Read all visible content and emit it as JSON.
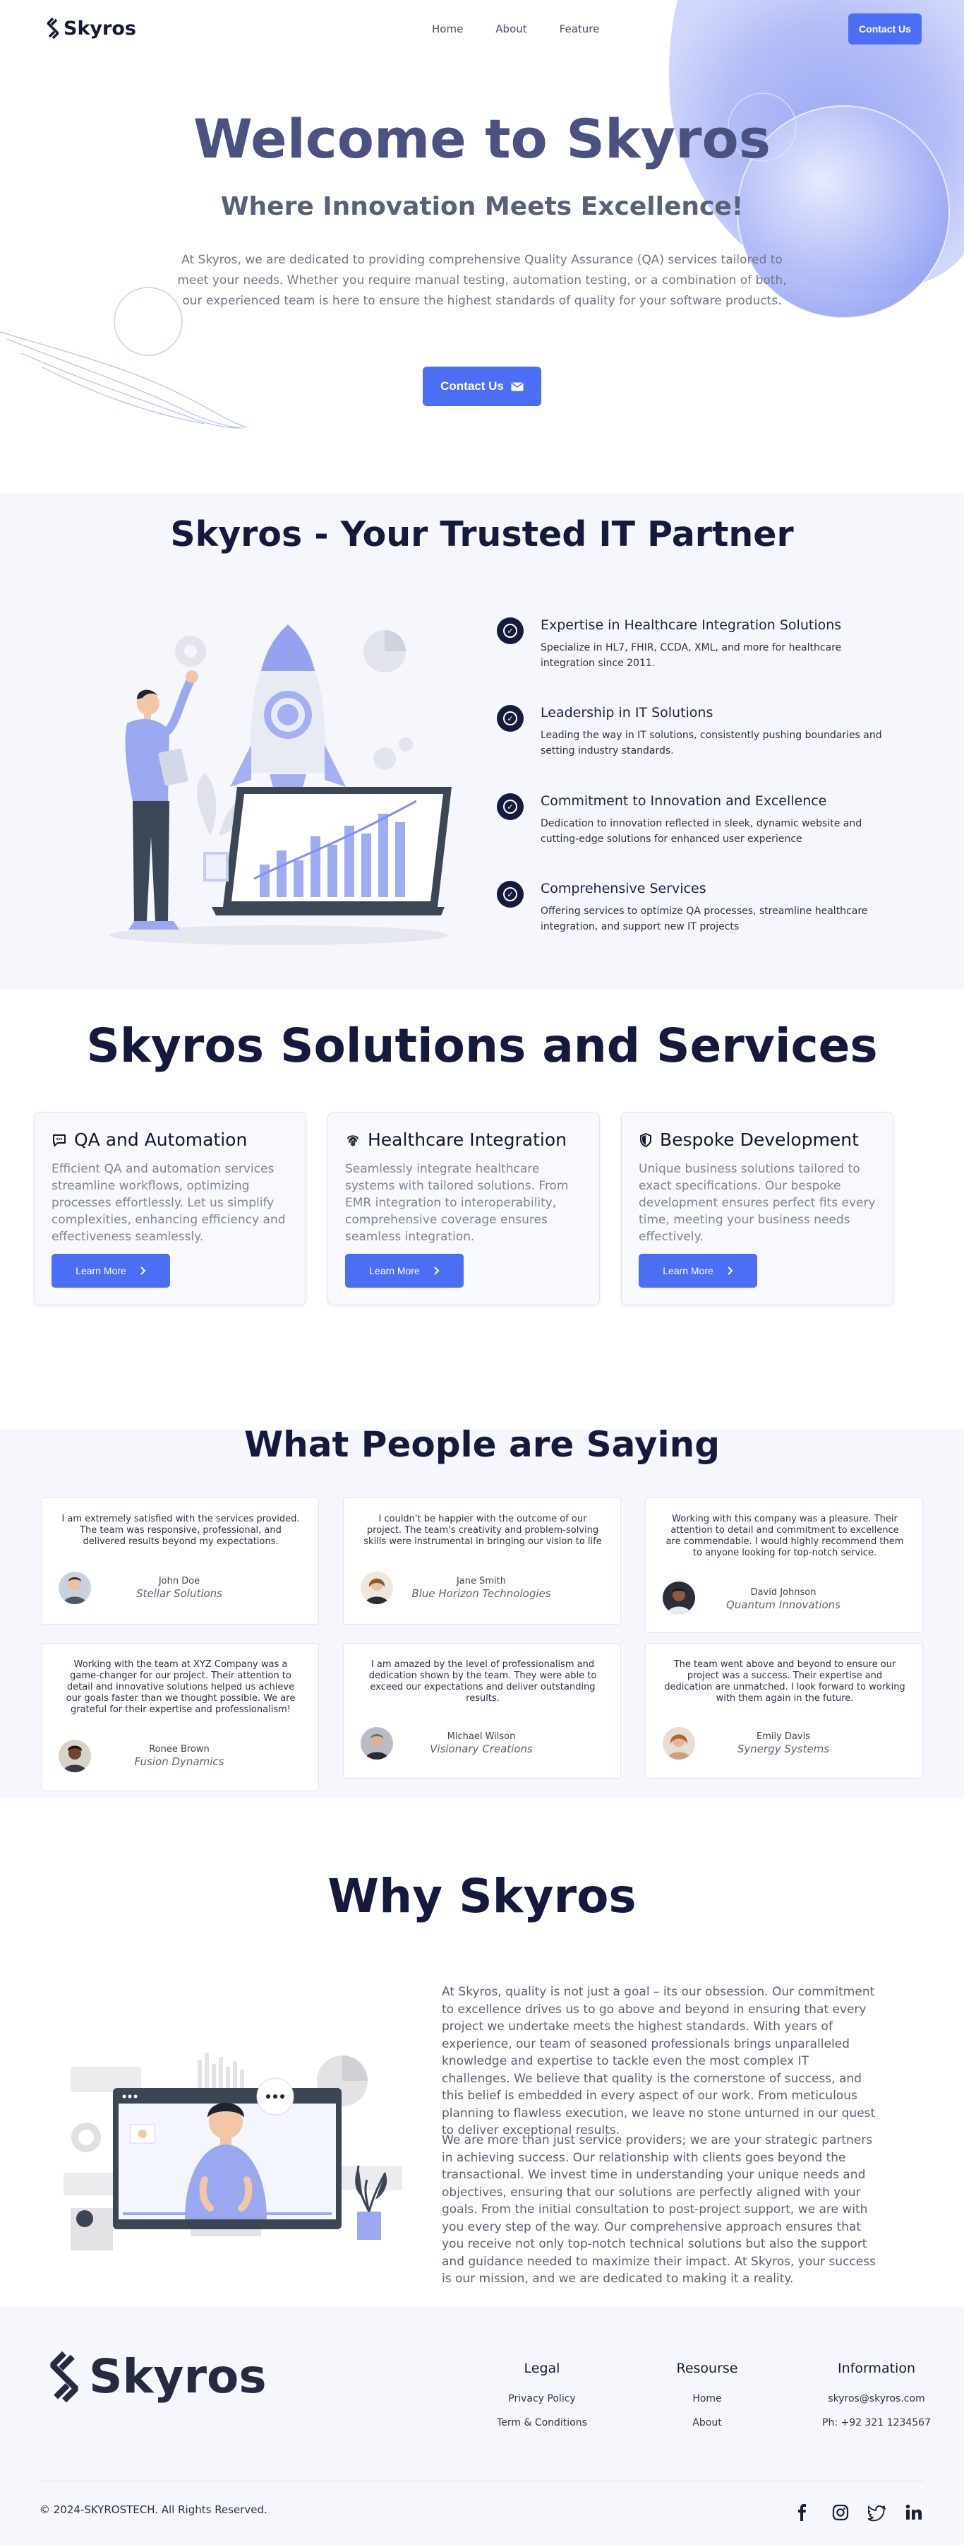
{
  "nav": {
    "brand": "Skyros",
    "links": [
      "Home",
      "About",
      "Feature"
    ],
    "cta": "Contact Us"
  },
  "hero": {
    "title": "Welcome to Skyros",
    "subtitle": "Where Innovation Meets Excellence!",
    "paragraph": "At Skyros, we are dedicated to providing comprehensive Quality Assurance (QA) services tailored to meet your needs. Whether you require manual testing, automation testing, or a combination of both, our experienced team is here to ensure the highest standards of quality for your software products.",
    "button": "Contact Us",
    "button_icon": "mail-icon"
  },
  "trusted": {
    "title": "Skyros - Your Trusted IT Partner",
    "illustration": "rocket-growth-illustration",
    "items": [
      {
        "title": "Expertise in Healthcare Integration Solutions",
        "text": "Specialize in HL7, FHIR, CCDA, XML, and more for healthcare integration since 2011."
      },
      {
        "title": "Leadership in IT Solutions",
        "text": "Leading the way in IT solutions, consistently pushing boundaries and setting industry standards."
      },
      {
        "title": "Commitment to Innovation and Excellence",
        "text": "Dedication to innovation reflected in sleek, dynamic website and cutting-edge solutions for enhanced user experience"
      },
      {
        "title": "Comprehensive Services",
        "text": "Offering services to optimize QA processes, streamline healthcare integration, and support new IT projects"
      }
    ]
  },
  "services": {
    "title": "Skyros Solutions and Services",
    "cards": [
      {
        "title": "QA and Automation",
        "icon": "chat-icon",
        "text": "Efficient QA and automation services streamline workflows, optimizing processes effortlessly. Let us simplify complexities, enhancing efficiency and effectiveness seamlessly.",
        "button": "Learn More"
      },
      {
        "title": "Healthcare Integration",
        "icon": "fingerprint-icon",
        "text": "Seamlessly integrate healthcare systems with tailored solutions. From EMR integration to interoperability, comprehensive coverage ensures seamless integration.",
        "button": "Learn More"
      },
      {
        "title": "Bespoke Development",
        "icon": "shield-icon",
        "text": "Unique business solutions tailored to exact specifications. Our bespoke development ensures perfect fits every time, meeting your business needs effectively.",
        "button": "Learn More"
      }
    ]
  },
  "testimonials": {
    "title": "What People are Saying",
    "items": [
      {
        "quote": "I am extremely satisfied with the services provided. The team was responsive, professional, and delivered results beyond my expectations.",
        "name": "John Doe",
        "company": "Stellar Solutions"
      },
      {
        "quote": "I couldn't be happier with the outcome of our project. The team's creativity and problem-solving skills were instrumental in bringing our vision to life",
        "name": "Jane Smith",
        "company": "Blue Horizon Technologies"
      },
      {
        "quote": "Working with this company was a pleasure. Their attention to detail and commitment to excellence are commendable. I would highly recommend them to anyone looking for top-notch service.",
        "name": "David Johnson",
        "company": "Quantum Innovations"
      },
      {
        "quote": "Working with the team at XYZ Company was a game-changer for our project. Their attention to detail and innovative solutions helped us achieve our goals faster than we thought possible. We are grateful for their expertise and professionalism!",
        "name": "Ronee Brown",
        "company": "Fusion Dynamics"
      },
      {
        "quote": "I am amazed by the level of professionalism and dedication shown by the team. They were able to exceed our expectations and deliver outstanding results.",
        "name": "Michael Wilson",
        "company": "Visionary Creations"
      },
      {
        "quote": "The team went above and beyond to ensure our project was a success. Their expertise and dedication are unmatched. I look forward to working with them again in the future.",
        "name": "Emily Davis",
        "company": "Synergy Systems"
      }
    ]
  },
  "why": {
    "title": "Why Skyros",
    "illustration": "video-call-illustration",
    "paragraphs": [
      "At Skyros, quality is not just a goal – its our obsession. Our commitment to excellence drives us to go above and beyond in ensuring that every project we undertake meets the highest standards. With years of experience, our team of seasoned professionals brings unparalleled knowledge and expertise to tackle even the most complex IT challenges. We believe that quality is the cornerstone of success, and this belief is embedded in every aspect of our work. From meticulous planning to flawless execution, we leave no stone unturned in our quest to deliver exceptional results.",
      "We are more than just service providers; we are your strategic partners in achieving success. Our relationship with clients goes beyond the transactional. We invest time in understanding your unique needs and objectives, ensuring that our solutions are perfectly aligned with your goals. From the initial consultation to post-project support, we are with you every step of the way. Our comprehensive approach ensures that you receive not only top-notch technical solutions but also the support and guidance needed to maximize their impact. At Skyros, your success is our mission, and we are dedicated to making it a reality."
    ]
  },
  "footer": {
    "brand": "Skyros",
    "legal": {
      "title": "Legal",
      "links": [
        "Privacy Policy",
        "Term & Conditions"
      ]
    },
    "resource": {
      "title": "Resourse",
      "links": [
        "Home",
        "About"
      ]
    },
    "information": {
      "title": "Information",
      "links": [
        "skyros@skyros.com",
        "Ph: +92 321 1234567"
      ]
    },
    "copyright": "© 2024-SKYROSTECH. All Rights Reserved.",
    "social": [
      "facebook-icon",
      "instagram-icon",
      "twitter-icon",
      "linkedin-icon"
    ]
  },
  "colors": {
    "accent": "#4c6ef5",
    "navy": "#151a3d",
    "hero_title": "#4b5180",
    "section_bg": "#f5f7fd"
  }
}
